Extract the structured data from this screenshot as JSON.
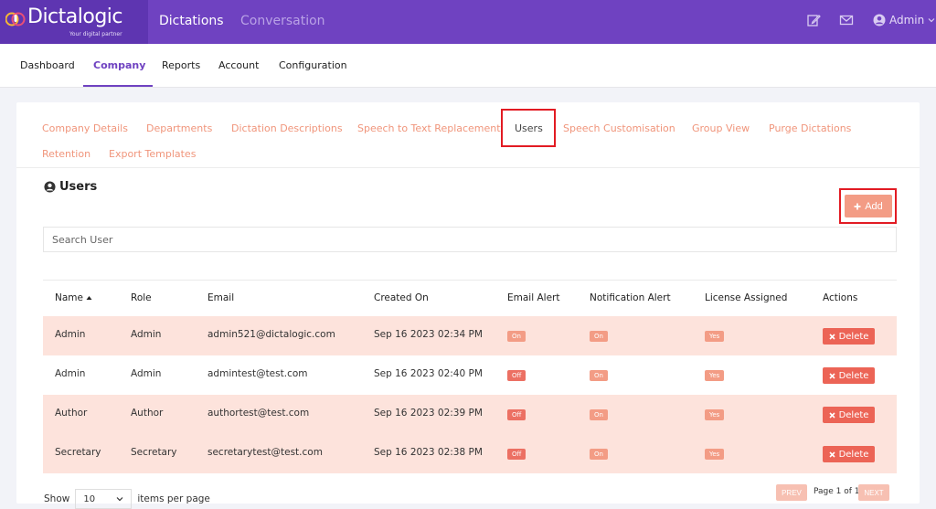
{
  "brand": {
    "name": "Dictalogic",
    "tagline": "Your digital partner",
    "colors": {
      "purple": "#6f42c1",
      "accent": "#f39c85",
      "danger": "#ec6456"
    }
  },
  "topnav": {
    "items": [
      "Dictations",
      "Conversation"
    ],
    "active": "Dictations"
  },
  "header_icons": [
    "edit-icon",
    "mail-icon",
    "user-circle-icon"
  ],
  "user": {
    "name": "Admin"
  },
  "subnav": {
    "items": [
      "Dashboard",
      "Company",
      "Reports",
      "Account",
      "Configuration"
    ],
    "active": "Company"
  },
  "tabs": {
    "items": [
      "Company Details",
      "Departments",
      "Dictation Descriptions",
      "Speech to Text Replacement",
      "Users",
      "Speech Customisation",
      "Group View",
      "Purge Dictations",
      "Retention",
      "Export Templates"
    ],
    "active": "Users"
  },
  "section": {
    "title": "Users",
    "icon": "user-circle-icon"
  },
  "add_button": {
    "label": "Add",
    "icon": "plus-icon"
  },
  "search": {
    "placeholder": "Search User",
    "value": ""
  },
  "table": {
    "columns": [
      "Name",
      "Role",
      "Email",
      "Created On",
      "Email Alert",
      "Notification Alert",
      "License Assigned",
      "Actions"
    ],
    "sort": {
      "column": "Name",
      "direction": "asc"
    },
    "rows": [
      {
        "name": "Admin",
        "role": "Admin",
        "email": "admin521@dictalogic.com",
        "created_on": "Sep 16 2023 02:34 PM",
        "email_alert": "On",
        "notification_alert": "On",
        "license": "Yes",
        "action": "Delete"
      },
      {
        "name": "Admin",
        "role": "Admin",
        "email": "admintest@test.com",
        "created_on": "Sep 16 2023 02:40 PM",
        "email_alert": "Off",
        "notification_alert": "On",
        "license": "Yes",
        "action": "Delete"
      },
      {
        "name": "Author",
        "role": "Author",
        "email": "authortest@test.com",
        "created_on": "Sep 16 2023 02:39 PM",
        "email_alert": "Off",
        "notification_alert": "On",
        "license": "Yes",
        "action": "Delete"
      },
      {
        "name": "Secretary",
        "role": "Secretary",
        "email": "secretarytest@test.com",
        "created_on": "Sep 16 2023 02:38 PM",
        "email_alert": "Off",
        "notification_alert": "On",
        "license": "Yes",
        "action": "Delete"
      }
    ]
  },
  "pagination": {
    "show_label": "Show",
    "per_page": "10",
    "items_label": "items per page",
    "prev": "PREV",
    "next": "NEXT",
    "page_text": "Page 1 of 1"
  }
}
